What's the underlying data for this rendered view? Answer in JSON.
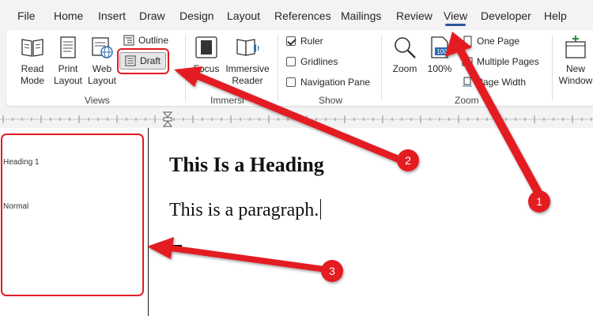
{
  "tabs": [
    {
      "label": "File"
    },
    {
      "label": "Home"
    },
    {
      "label": "Insert"
    },
    {
      "label": "Draw"
    },
    {
      "label": "Design"
    },
    {
      "label": "Layout"
    },
    {
      "label": "References"
    },
    {
      "label": "Mailings"
    },
    {
      "label": "Review"
    },
    {
      "label": "View",
      "active": true
    },
    {
      "label": "Developer"
    },
    {
      "label": "Help"
    }
  ],
  "ribbon": {
    "views": {
      "read_mode": "Read Mode",
      "print_layout": "Print Layout",
      "web_layout": "Web Layout",
      "outline": "Outline",
      "draft": "Draft",
      "group_label": "Views"
    },
    "immersive": {
      "focus": "Focus",
      "immersive_reader": "Immersive Reader",
      "group_label": "Immersi"
    },
    "show": {
      "ruler": "Ruler",
      "ruler_checked": true,
      "gridlines": "Gridlines",
      "gridlines_checked": false,
      "navigation_pane": "Navigation Pane",
      "navigation_pane_checked": false,
      "group_label": "Show"
    },
    "zoom": {
      "zoom": "Zoom",
      "percent": "100%",
      "percent_icon_text": "100",
      "one_page": "One Page",
      "multiple_pages": "Multiple Pages",
      "page_width": "Page Width",
      "group_label": "Zoom"
    },
    "window": {
      "new_window": "New Window"
    }
  },
  "style_pane": {
    "items": [
      "Heading 1",
      "Normal"
    ]
  },
  "document": {
    "heading": "This Is a Heading",
    "paragraph": "This is a paragraph."
  },
  "annotations": {
    "badges": [
      "1",
      "2",
      "3"
    ],
    "color": "#e31b23"
  },
  "colors": {
    "accent": "#2b579a",
    "annotation": "#e31b23"
  }
}
